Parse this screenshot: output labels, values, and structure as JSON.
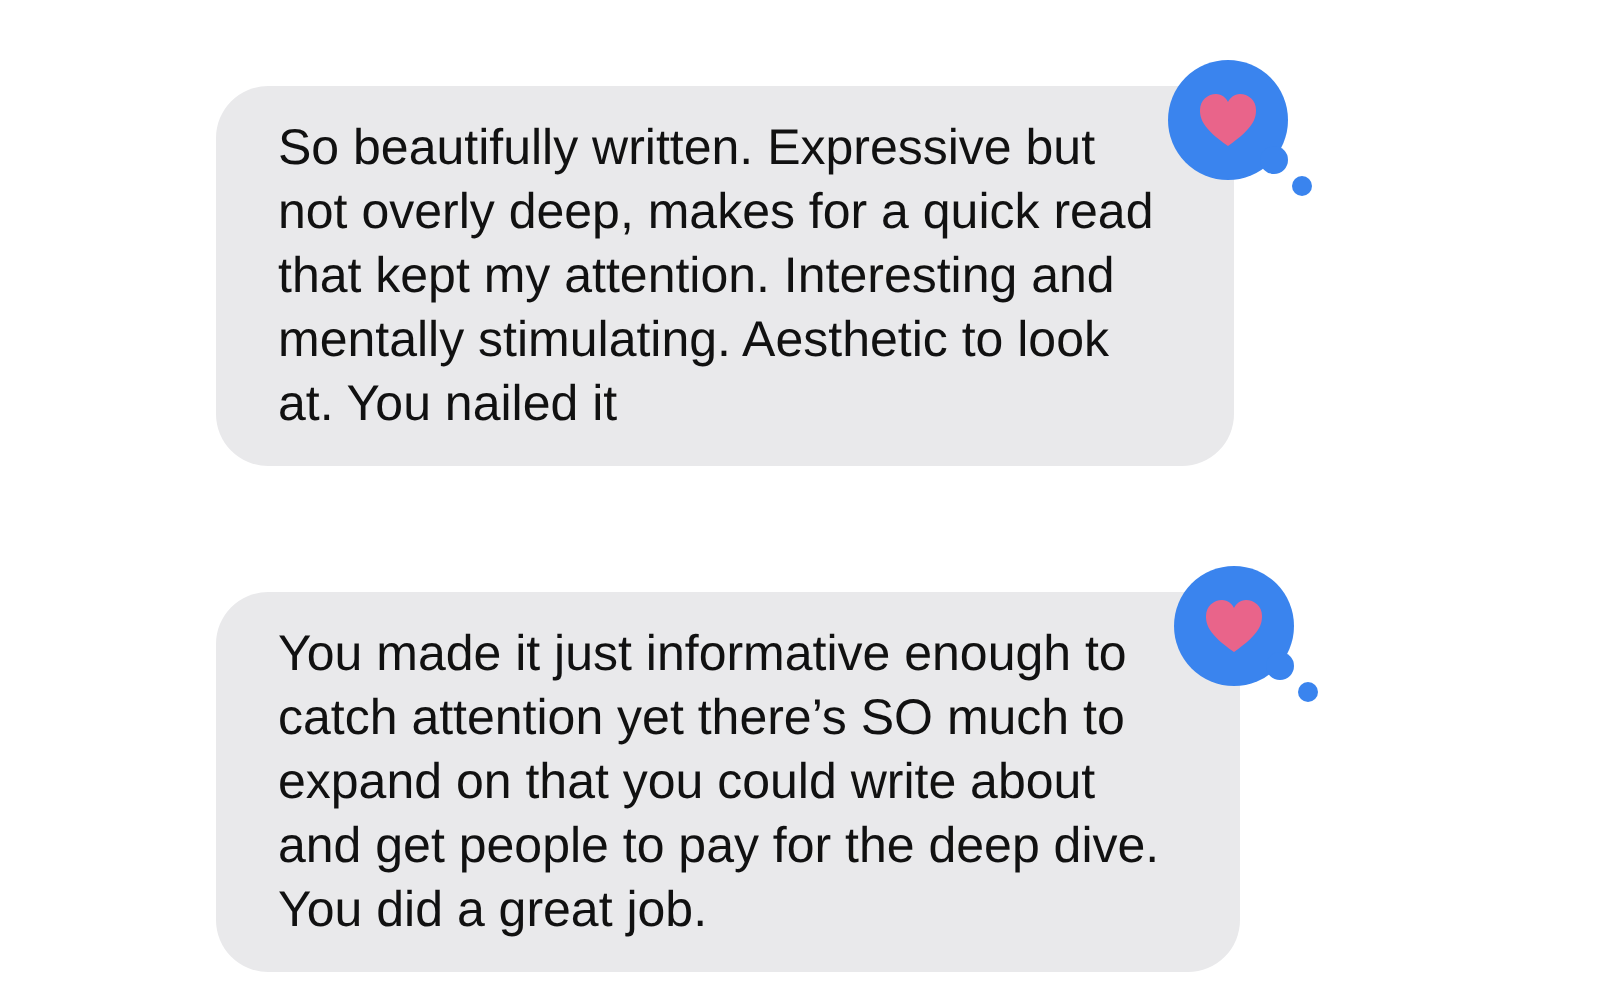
{
  "messages": [
    {
      "text": "So beautifully written. Expressive but\nnot overly deep, makes for a quick read\nthat kept my attention. Interesting and\nmentally stimulating. Aesthetic to look\nat. You nailed it",
      "reaction": {
        "kind": "heart"
      }
    },
    {
      "text": "You made it just informative enough to\ncatch attention yet there’s SO much to\nexpand on that you could write about\nand get people to pay for the deep dive.\nYou did a great job.",
      "reaction": {
        "kind": "heart"
      }
    }
  ]
}
